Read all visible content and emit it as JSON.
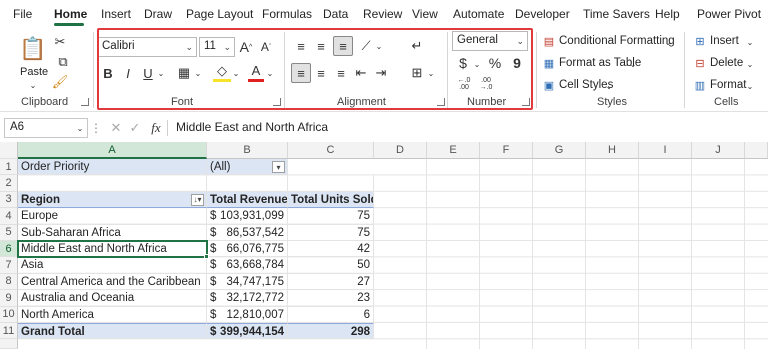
{
  "menu": {
    "tabs": [
      "File",
      "Home",
      "Insert",
      "Draw",
      "Page Layout",
      "Formulas",
      "Data",
      "Review",
      "View",
      "Automate",
      "Developer",
      "Time Savers",
      "Help",
      "Power Pivot"
    ],
    "active": "Home"
  },
  "ribbon": {
    "clipboard": {
      "paste": "Paste",
      "label": "Clipboard"
    },
    "font": {
      "name": "Calibri",
      "size": "11",
      "label": "Font",
      "grow": "A",
      "shrink": "A",
      "bold": "B",
      "italic": "I",
      "underline": "U",
      "color_a": "A"
    },
    "alignment": {
      "label": "Alignment"
    },
    "number": {
      "format": "General",
      "label": "Number",
      "currency": "$",
      "percent": "%",
      "comma": "9",
      "inc": "←.0 .00",
      "dec": ".00 →.0"
    },
    "styles": {
      "conditional": "Conditional Formatting",
      "format_table": "Format as Table",
      "cell_styles": "Cell Styles",
      "label": "Styles"
    },
    "cells": {
      "insert": "Insert",
      "delete": "Delete",
      "format": "Format",
      "label": "Cells"
    }
  },
  "formula_bar": {
    "name_box": "A6",
    "fx": "fx",
    "content": "Middle East and North Africa"
  },
  "grid": {
    "columns": [
      "A",
      "B",
      "C",
      "D",
      "E",
      "F",
      "G",
      "H",
      "I",
      "J"
    ],
    "rows": [
      "1",
      "2",
      "3",
      "4",
      "5",
      "6",
      "7",
      "8",
      "9",
      "10",
      "11"
    ],
    "filter": {
      "label": "Order Priority",
      "value": "(All)"
    },
    "headers": {
      "region": "Region",
      "revenue": "Total Revenue",
      "units": "Total Units Sold"
    },
    "data": [
      {
        "region": "Europe",
        "cur": "$",
        "revenue": "103,931,099",
        "units": "75"
      },
      {
        "region": "Sub-Saharan Africa",
        "cur": "$",
        "revenue": "86,537,542",
        "units": "75"
      },
      {
        "region": "Middle East and North Africa",
        "cur": "$",
        "revenue": "66,076,775",
        "units": "42"
      },
      {
        "region": "Asia",
        "cur": "$",
        "revenue": "63,668,784",
        "units": "50"
      },
      {
        "region": "Central America and the Caribbean",
        "cur": "$",
        "revenue": "34,747,175",
        "units": "27"
      },
      {
        "region": "Australia and Oceania",
        "cur": "$",
        "revenue": "32,172,772",
        "units": "23"
      },
      {
        "region": "North America",
        "cur": "$",
        "revenue": "12,810,007",
        "units": "6"
      }
    ],
    "total": {
      "label": "Grand Total",
      "cur": "$",
      "revenue": "399,944,154",
      "units": "298"
    }
  },
  "colors": {
    "accent": "#217346",
    "highlight": "#e0393e",
    "pivot_blue": "#dbe5f4"
  }
}
